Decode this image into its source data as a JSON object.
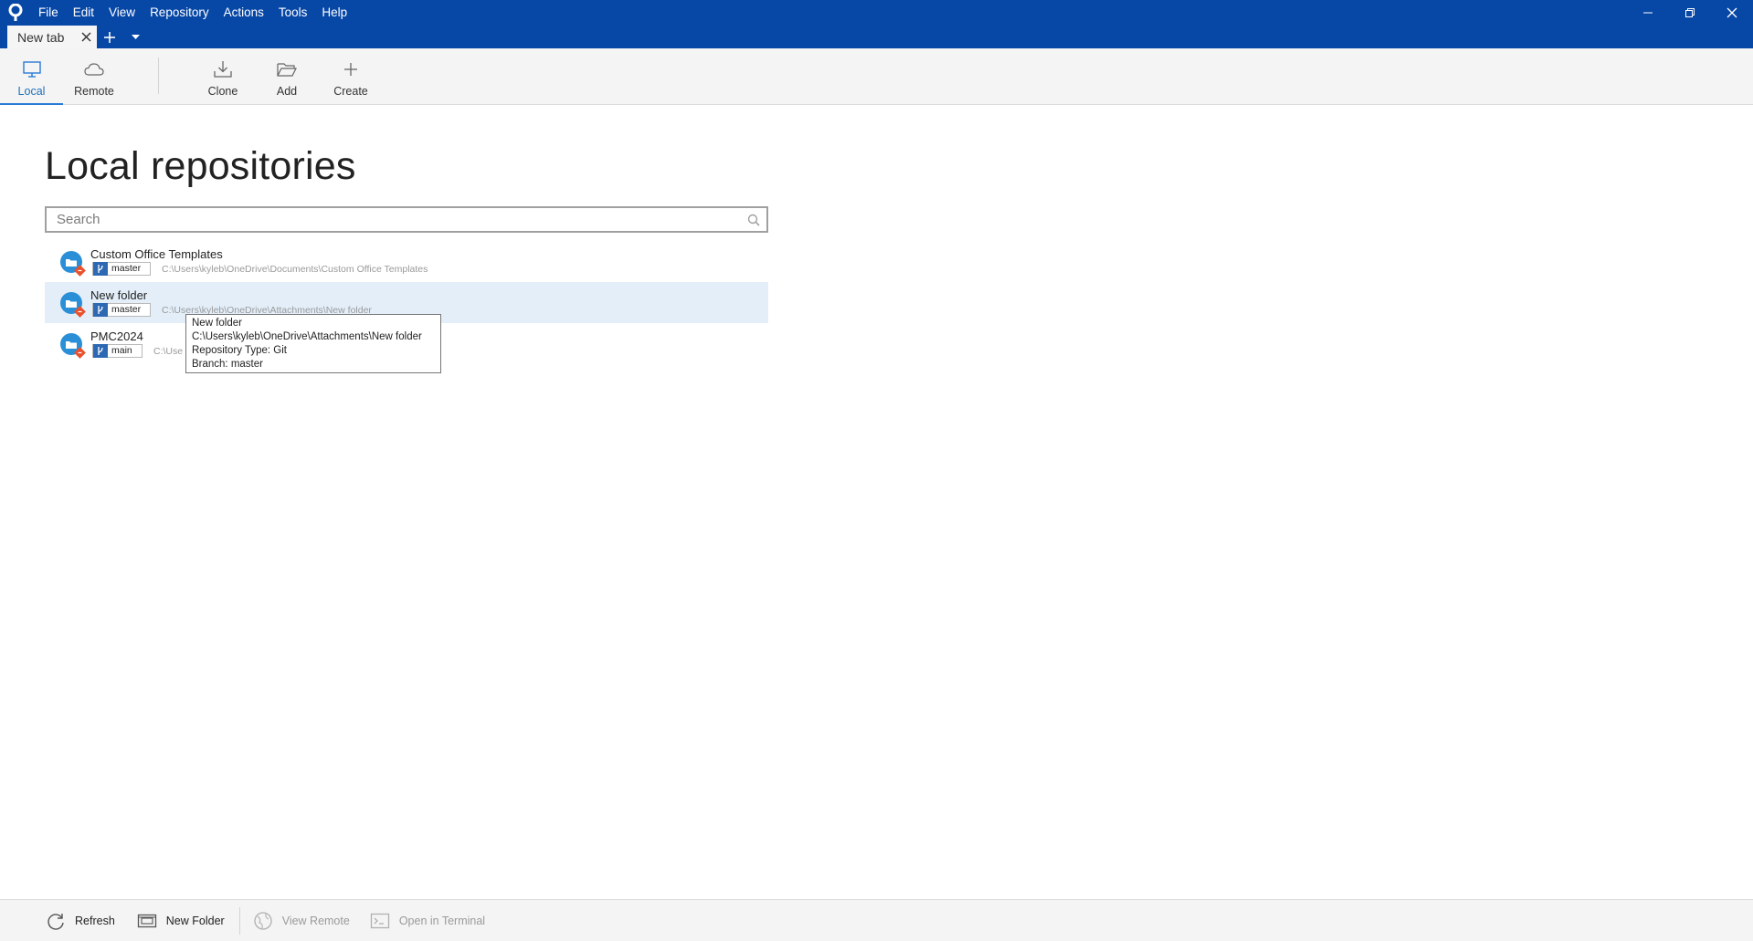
{
  "app": {
    "menu": [
      "File",
      "Edit",
      "View",
      "Repository",
      "Actions",
      "Tools",
      "Help"
    ]
  },
  "tabs": [
    {
      "label": "New tab"
    }
  ],
  "toolbar": {
    "local": "Local",
    "remote": "Remote",
    "clone": "Clone",
    "add": "Add",
    "create": "Create"
  },
  "main": {
    "title": "Local repositories",
    "search_placeholder": "Search",
    "repos": [
      {
        "name": "Custom Office Templates",
        "branch": "master",
        "path": "C:\\Users\\kyleb\\OneDrive\\Documents\\Custom Office Templates",
        "selected": false
      },
      {
        "name": "New folder",
        "branch": "master",
        "path": "C:\\Users\\kyleb\\OneDrive\\Attachments\\New folder",
        "selected": true
      },
      {
        "name": "PMC2024",
        "branch": "main",
        "path": "C:\\Use",
        "selected": false
      }
    ]
  },
  "tooltip": {
    "line1": "New folder",
    "line2": "C:\\Users\\kyleb\\OneDrive\\Attachments\\New folder",
    "line3": "Repository Type: Git",
    "line4": "Branch: master"
  },
  "bottombar": {
    "refresh": "Refresh",
    "new_folder": "New Folder",
    "view_remote": "View Remote",
    "open_terminal": "Open in Terminal"
  },
  "colors": {
    "titlebar": "#0747a6",
    "accent": "#2a7bd6",
    "selected_row": "#e3eef9"
  }
}
